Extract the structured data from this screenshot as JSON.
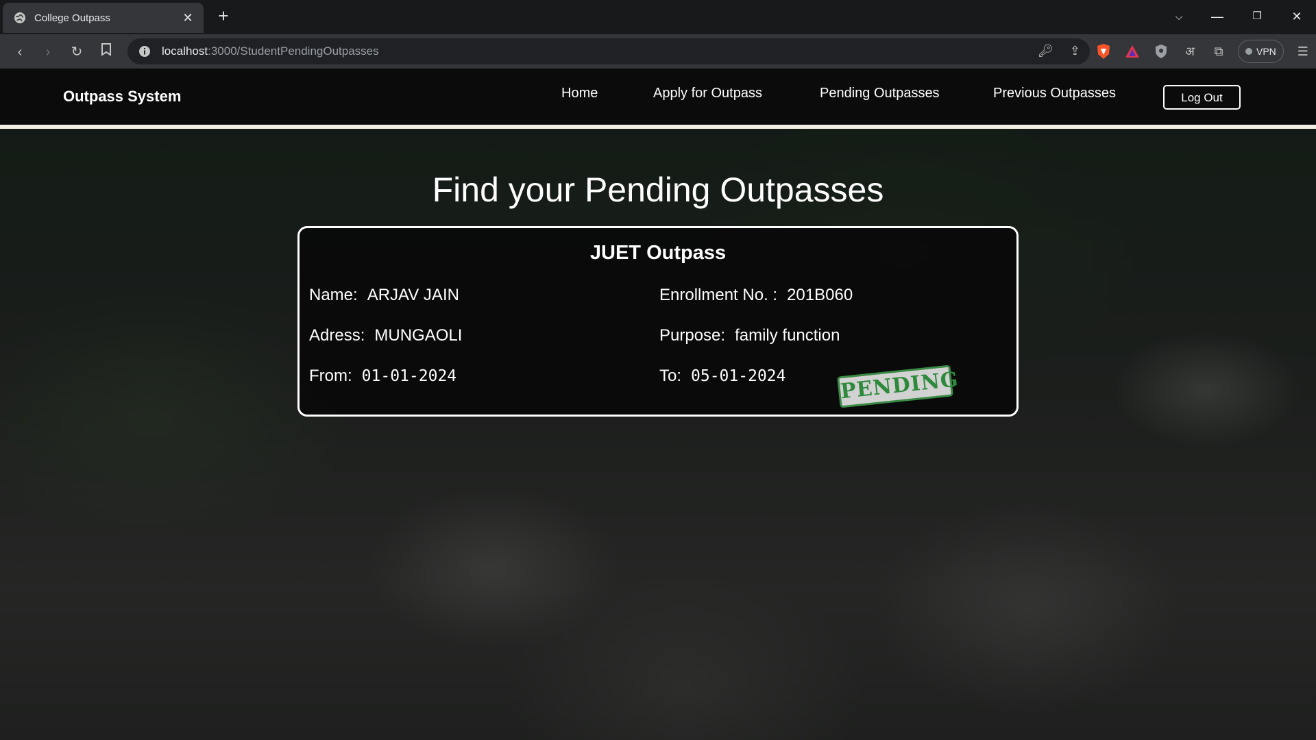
{
  "browser": {
    "tab_title": "College Outpass",
    "url_host": "localhost",
    "url_rest": ":3000/StudentPendingOutpasses",
    "vpn_label": "VPN"
  },
  "navbar": {
    "brand": "Outpass System",
    "links": [
      "Home",
      "Apply for Outpass",
      "Pending Outpasses",
      "Previous Outpasses"
    ],
    "logout_label": "Log Out"
  },
  "main": {
    "heading": "Find your Pending Outpasses"
  },
  "outpass_card": {
    "title": "JUET Outpass",
    "name_label": "Name:",
    "name_value": "ARJAV JAIN",
    "enrollment_label": "Enrollment No. :",
    "enrollment_value": "201B060",
    "address_label": "Adress:",
    "address_value": "MUNGAOLI",
    "purpose_label": "Purpose:",
    "purpose_value": "family function",
    "from_label": "From:",
    "from_value": "01-01-2024",
    "to_label": "To:",
    "to_value": "05-01-2024",
    "status_stamp": "PENDING"
  },
  "colors": {
    "navbar_bg": "#0b0b0c",
    "card_border": "#ffffff",
    "stamp_green": "#2d8a3b"
  }
}
